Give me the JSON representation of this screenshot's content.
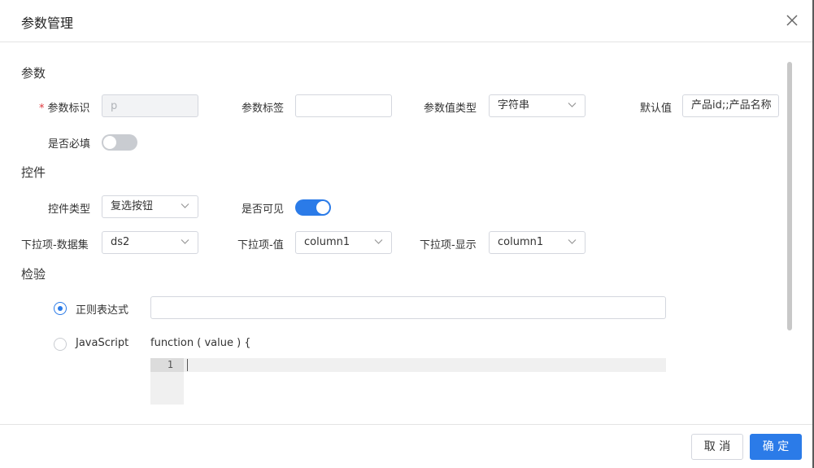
{
  "dialog": {
    "title": "参数管理",
    "close_icon": "close-icon"
  },
  "sections": {
    "param": "参数",
    "control": "控件",
    "validation": "检验"
  },
  "param": {
    "id_label": "参数标识",
    "id_required_mark": "*",
    "id_value": "p",
    "tag_label": "参数标签",
    "tag_value": "",
    "value_type_label": "参数值类型",
    "value_type_selected": "字符串",
    "default_label": "默认值",
    "default_value": "产品id;;产品名称",
    "required_label": "是否必填",
    "required_on": false
  },
  "control": {
    "type_label": "控件类型",
    "type_selected": "复选按钮",
    "visible_label": "是否可见",
    "visible_on": true,
    "dataset_label": "下拉项-数据集",
    "dataset_selected": "ds2",
    "value_label": "下拉项-值",
    "value_selected": "column1",
    "display_label": "下拉项-显示",
    "display_selected": "column1"
  },
  "validation": {
    "regex_label": "正则表达式",
    "regex_checked": true,
    "regex_value": "",
    "js_label": "JavaScript",
    "js_checked": false,
    "js_signature": "function ( value ) {",
    "editor_line_number": "1"
  },
  "footer": {
    "cancel_label": "取 消",
    "ok_label": "确 定"
  },
  "colors": {
    "primary": "#2b7be8",
    "required": "#e0393e",
    "switch_off": "#c9ccd1"
  }
}
